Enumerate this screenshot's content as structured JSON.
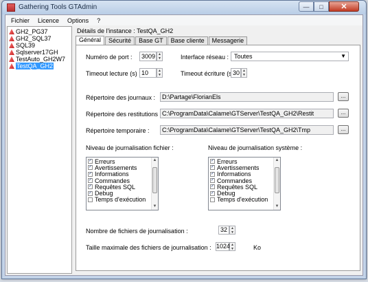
{
  "window": {
    "title": "Gathering Tools GTAdmin",
    "close_glyph": "✕",
    "min_glyph": "—",
    "max_glyph": "□"
  },
  "menu": [
    "Fichier",
    "Licence",
    "Options",
    "?"
  ],
  "tree": {
    "items": [
      "GH2_PG37",
      "GH2_SQL37",
      "SQL39",
      "Sqlserver17GH",
      "TestAuto_GH2W7",
      "TestQA_GH2"
    ],
    "selected": "TestQA_GH2"
  },
  "instance_label": "Détails de l'instance : TestQA_GH2",
  "tabs": [
    "Général",
    "Sécurité",
    "Base GT",
    "Base cliente",
    "Messagerie"
  ],
  "general": {
    "port_label": "Numéro de port :",
    "port_value": "3009",
    "iface_label": "Interface réseau :",
    "iface_value": "Toutes",
    "read_timeout_label": "Timeout lecture (s) :",
    "read_timeout_value": "10",
    "write_timeout_label": "Timeout écriture (s) :",
    "write_timeout_value": "30",
    "journals_label": "Répertoire des journaux :",
    "journals_value": "D:\\Partage\\FlorianEls",
    "restitutions_label": "Répertoire des restitutions :",
    "restitutions_value": "C:\\ProgramData\\Calame\\GTServer\\TestQA_GH2\\Restit",
    "temp_label": "Répertoire temporaire :",
    "temp_value": "C:\\ProgramData\\Calame\\GTServer\\TestQA_GH2\\Tmp",
    "browse_label": "...",
    "file_log_label": "Niveau de journalisation fichier :",
    "sys_log_label": "Niveau de journalisation système :",
    "file_levels": [
      {
        "label": "Erreurs",
        "checked": true
      },
      {
        "label": "Avertissements",
        "checked": true
      },
      {
        "label": "Informations",
        "checked": true
      },
      {
        "label": "Commandes",
        "checked": true
      },
      {
        "label": "Requêtes SQL",
        "checked": true
      },
      {
        "label": "Debug",
        "checked": true
      },
      {
        "label": "Temps d'exécution",
        "checked": false
      }
    ],
    "sys_levels": [
      {
        "label": "Erreurs",
        "checked": true
      },
      {
        "label": "Avertissements",
        "checked": true
      },
      {
        "label": "Informations",
        "checked": true
      },
      {
        "label": "Commandes",
        "checked": true
      },
      {
        "label": "Requêtes SQL",
        "checked": true
      },
      {
        "label": "Debug",
        "checked": true
      },
      {
        "label": "Temps d'exécution",
        "checked": false
      }
    ],
    "nb_files_label": "Nombre de fichiers de journalisation :",
    "nb_files_value": "32",
    "max_size_label": "Taille maximale des fichiers de journalisation :",
    "max_size_value": "1024",
    "max_size_unit": "Ko"
  }
}
